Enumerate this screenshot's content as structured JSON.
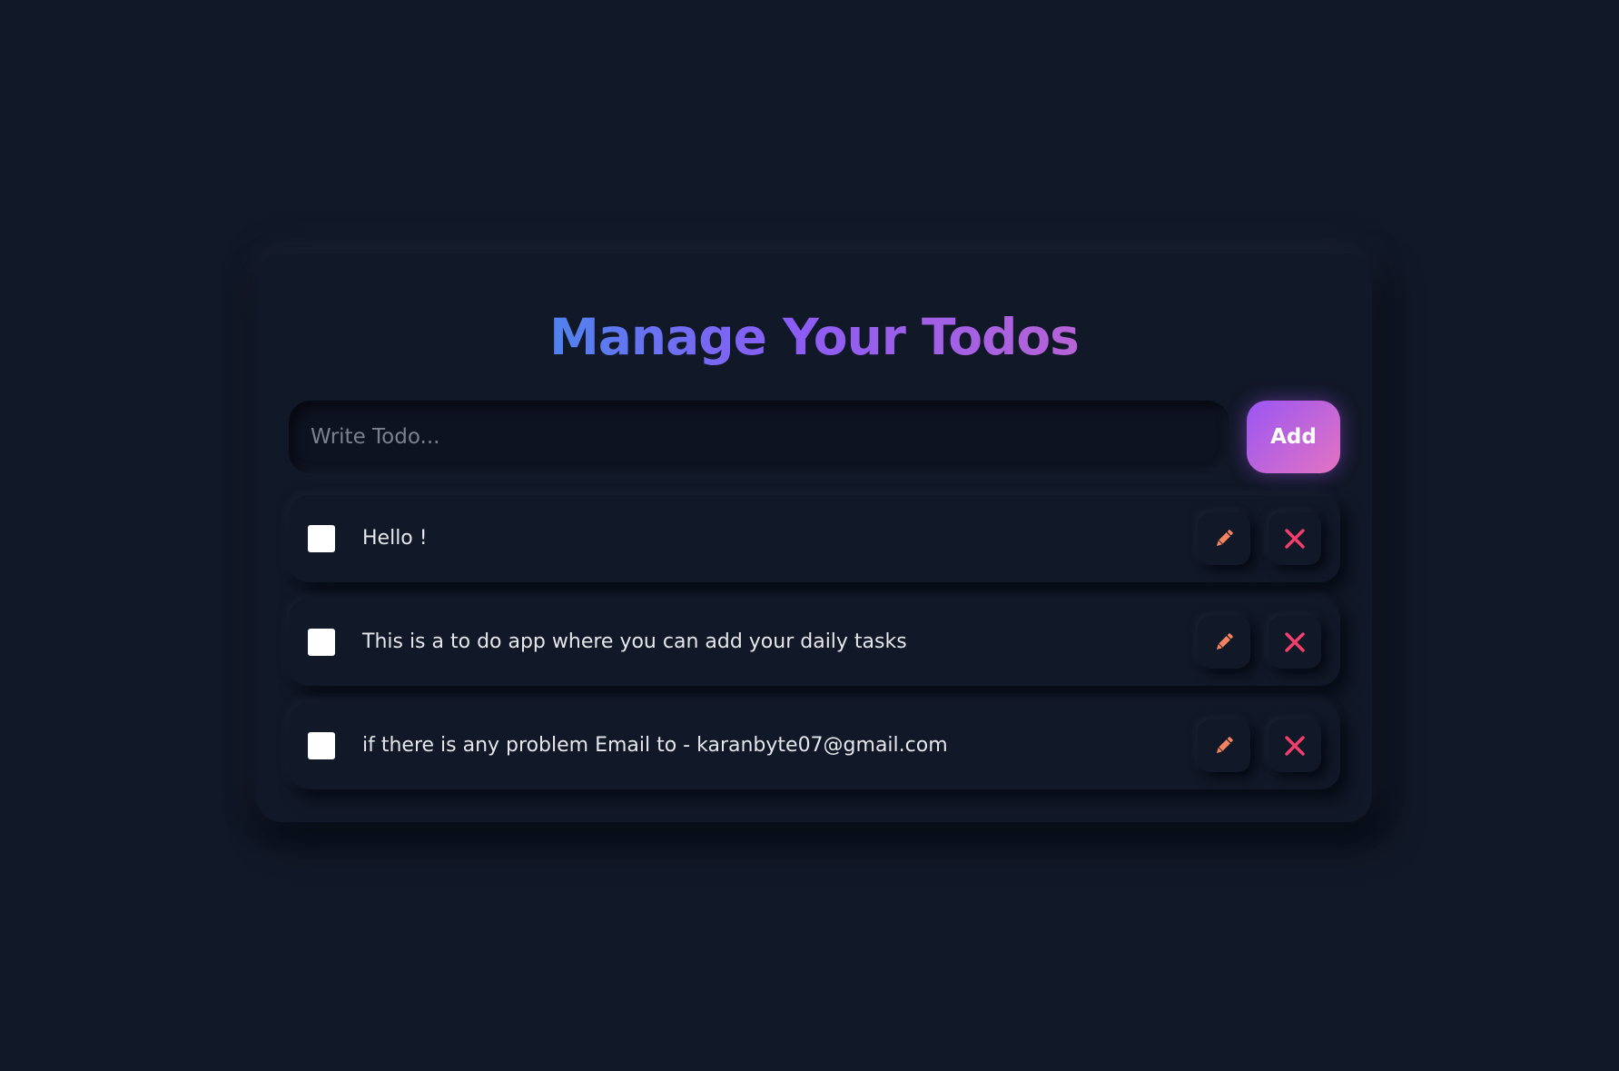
{
  "header": {
    "title": "Manage Your Todos"
  },
  "input": {
    "placeholder": "Write Todo...",
    "value": ""
  },
  "add_button": {
    "label": "Add"
  },
  "todos": [
    {
      "text": "Hello !",
      "completed": false
    },
    {
      "text": "This is a to do app where you can add your daily tasks",
      "completed": false
    },
    {
      "text": "if there is any problem Email to - karanbyte07@gmail.com",
      "completed": false
    }
  ],
  "icons": {
    "edit": "pencil-icon",
    "delete": "close-icon"
  },
  "colors": {
    "background": "#111827",
    "title_gradient": [
      "#4f83ee",
      "#8b5cf6",
      "#b663d6"
    ],
    "add_button_gradient": [
      "#9a56f3",
      "#e373c2"
    ],
    "edit_icon": "#f4845f",
    "delete_icon": "#f43f6e",
    "text": "#e5e7eb",
    "placeholder": "#7b818e"
  }
}
